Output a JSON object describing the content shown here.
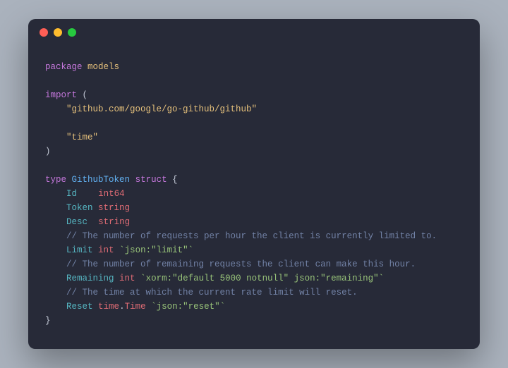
{
  "code": {
    "kw_package": "package",
    "pkg_name": "models",
    "kw_import": "import",
    "lparen": "(",
    "rparen": ")",
    "imports": {
      "i0": "\"github.com/google/go-github/github\"",
      "i1": "\"time\""
    },
    "kw_type": "type",
    "type_name": "GithubToken",
    "kw_struct": "struct",
    "lbrace": "{",
    "rbrace": "}",
    "fields": {
      "f0": {
        "name": "Id",
        "pad": "   ",
        "type": "int64"
      },
      "f1": {
        "name": "Token",
        "type": "string"
      },
      "f2": {
        "name": "Desc",
        "pad": " ",
        "type": "string"
      },
      "c0": "// The number of requests per hour the client is currently limited to.",
      "f3": {
        "name": "Limit",
        "type": "int",
        "tag": "`json:\"limit\"`"
      },
      "c1": "// The number of remaining requests the client can make this hour.",
      "f4": {
        "name": "Remaining",
        "type": "int",
        "tag": "`xorm:\"default 5000 notnull\" json:\"remaining\"`"
      },
      "c2": "// The time at which the current rate limit will reset.",
      "f5": {
        "name": "Reset",
        "type_pkg": "time",
        "type_dot": ".",
        "type_name": "Time",
        "tag": "`json:\"reset\"`"
      }
    }
  },
  "window": {
    "close": "close",
    "minimize": "minimize",
    "zoom": "zoom"
  }
}
